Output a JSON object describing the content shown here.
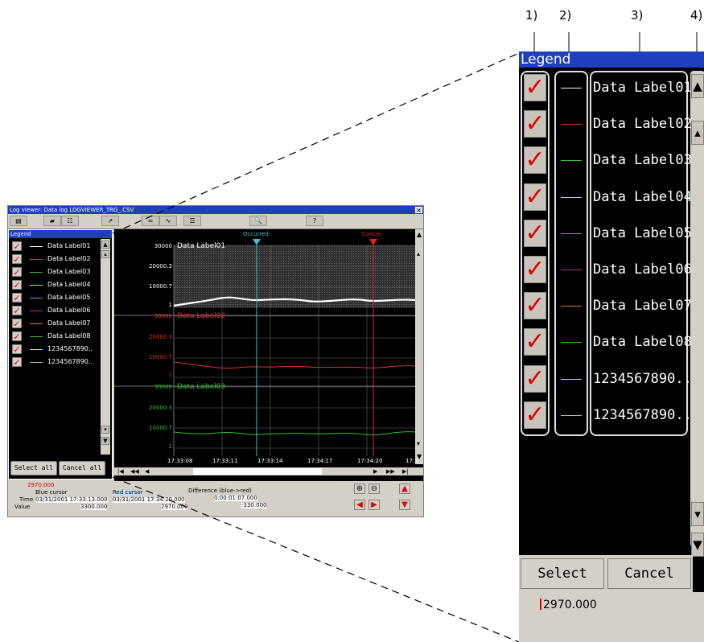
{
  "window": {
    "title": "Log viewer: Data log LOGVIEWER_TRG_.CSV",
    "close_glyph": "✕"
  },
  "toolbar_icons": [
    "file-icon",
    "folder-icon",
    "cursor-icon",
    "trend-icon",
    "wave-icon",
    "list-icon",
    "search-icon",
    "help-icon"
  ],
  "legend": {
    "header": "Legend",
    "items": [
      {
        "label": "Data Label01",
        "color": "#ffffff"
      },
      {
        "label": "Data Label02",
        "color": "#e03030"
      },
      {
        "label": "Data Label03",
        "color": "#30c030"
      },
      {
        "label": "Data Label04",
        "color": "#e0d040"
      },
      {
        "label": "Data Label05",
        "color": "#40b0c0"
      },
      {
        "label": "Data Label06",
        "color": "#a030a0"
      },
      {
        "label": "Data Label07",
        "color": "#e08020"
      },
      {
        "label": "Data Label08",
        "color": "#30c030"
      },
      {
        "label": "1234567890..",
        "color": "#e0e060"
      },
      {
        "label": "1234567890..",
        "color": "#a0c0c0"
      }
    ],
    "select_all": "Select all",
    "cancel_all": "Cancel all"
  },
  "graph": {
    "markers": {
      "occurred": "Occurred",
      "cancel": "Cancel"
    },
    "panels": [
      {
        "name": "Data Label01",
        "ticks": [
          "30000",
          "20000.3",
          "10000.7",
          "1"
        ],
        "color": "#ffffff"
      },
      {
        "name": "Data Label02",
        "ticks": [
          "30000",
          "20000.3",
          "10000.7",
          "1"
        ],
        "color": "#e03030"
      },
      {
        "name": "Data Label03",
        "ticks": [
          "30000",
          "20000.3",
          "10000.7",
          "1"
        ],
        "color": "#30c030"
      }
    ],
    "times": [
      "17:33:08",
      "17:33:11",
      "17:33:14",
      "17:34:17",
      "17:34:20",
      "17:3"
    ]
  },
  "cursor_panel": {
    "top_value": "2970.000",
    "blue_cursor": "Blue cursor",
    "red_cursor": "Red cursor",
    "difference": "Difference (blue->red)",
    "time_label": "Time",
    "value_label": "Value",
    "blue_time": "03/31/2001 17:33:13.000",
    "red_time": "03/31/2001 17:34:20.000",
    "diff_time": "0:00:01:07.000",
    "blue_value": "3300.000",
    "red_value": "2970.000",
    "diff_value": "-330.000"
  },
  "zoom": {
    "header": "Legend",
    "status_value": "2970.000"
  },
  "callouts": [
    "1)",
    "2)",
    "3)",
    "4)",
    "4)"
  ],
  "colors": {
    "title_blue": "#1f3fc0",
    "check_red": "#e00000",
    "panel_gray": "#d4d0c8"
  }
}
